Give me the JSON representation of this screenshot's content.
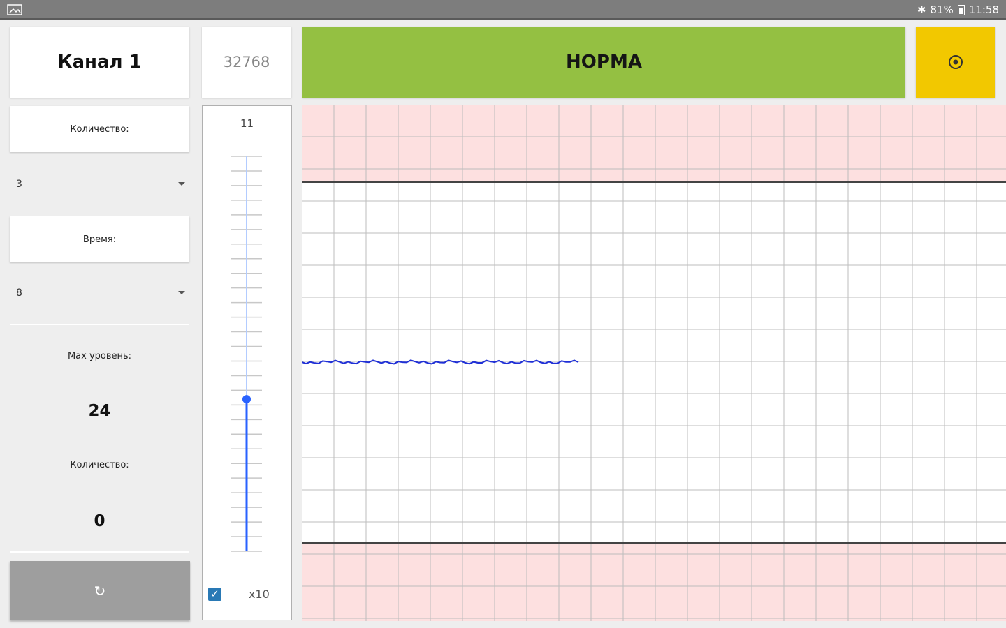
{
  "statusbar": {
    "battery": "81%",
    "time": "11:58",
    "icons": [
      "image-icon",
      "bluetooth-icon",
      "battery-icon"
    ]
  },
  "left_panel": {
    "channel_title": "Канал 1",
    "count_label": "Количество:",
    "count_select_value": "3",
    "time_label": "Время:",
    "time_select_value": "8",
    "max_levels_label": "Max уровень:",
    "max_levels_value": "24",
    "count2_label": "Количество:",
    "count2_value": "0",
    "reset_icon": "↻"
  },
  "middle_panel": {
    "raw_value": "32768",
    "slider_value": "11",
    "slider_fraction": 0.385,
    "multiplier_checked": true,
    "check_glyph": "✓",
    "multiplier_label": "x10"
  },
  "header": {
    "status_label": "НОРМА",
    "record_icon": "⊙"
  },
  "colors": {
    "status_ok": "#94c042",
    "record": "#f2c800",
    "danger_zone": "#fde0e0",
    "signal": "#1f2fd6",
    "slider_active": "#2962ff"
  }
}
